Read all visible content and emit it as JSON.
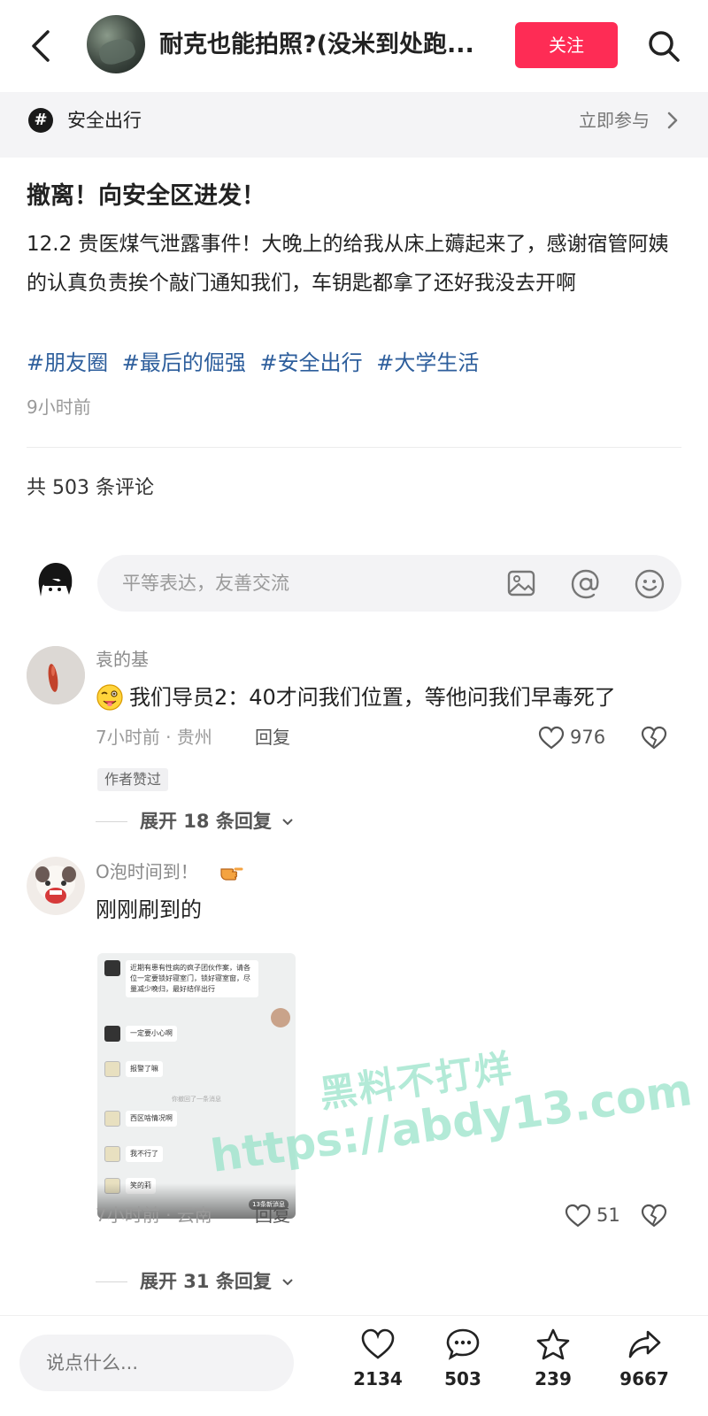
{
  "header": {
    "title": "耐克也能拍照?(没米到处跑...",
    "follow_label": "关注"
  },
  "topic": {
    "label": "安全出行",
    "join_label": "立即参与"
  },
  "post": {
    "heading": "撤离！向安全区进发！",
    "body": "12.2 贵医煤气泄露事件！大晚上的给我从床上薅起来了，感谢宿管阿姨的认真负责挨个敲门通知我们，车钥匙都拿了还好我没去开啊",
    "hashtags": [
      "#朋友圈",
      "#最后的倔强",
      "#安全出行",
      "#大学生活"
    ],
    "time": "9小时前",
    "comment_count": "共 503 条评论"
  },
  "comment_input": {
    "placeholder": "平等表达，友善交流"
  },
  "comments": [
    {
      "name": "袁的基",
      "text": "我们导员2：40才问我们位置，等他问我们早毒死了",
      "meta": "7小时前 · 贵州",
      "reply_label": "回复",
      "likes": "976",
      "badge": "作者赞过",
      "expand": "展开 18 条回复"
    },
    {
      "name": "O泡时间到！",
      "text": "刚刚刷到的",
      "meta": "7小时前 · 云南",
      "reply_label": "回复",
      "likes": "51",
      "expand": "展开 31 条回复",
      "image": {
        "msg1": "近期有患有性病的疯子团伙作案，请各位一定要锁好寝室门，锁好寝室窗，尽量减少晚归，最好结伴出行",
        "msg2": "一定要小心啊",
        "msg3": "报警了嘛",
        "sys": "你撤回了一条消息",
        "msg4": "西区啥情况啊",
        "msg5": "我不行了",
        "msg6": "笑的莉",
        "new_msgs": "13条新消息"
      }
    }
  ],
  "watermark": {
    "line1": "黑料不打烊",
    "line2": "https://abdy13.com"
  },
  "bottom_bar": {
    "placeholder": "说点什么...",
    "likes": "2134",
    "comments": "503",
    "favorites": "239",
    "shares": "9667"
  },
  "colors": {
    "accent": "#fe2c55",
    "hashtag": "#2d5e9c",
    "watermark": "#96e2c8"
  }
}
